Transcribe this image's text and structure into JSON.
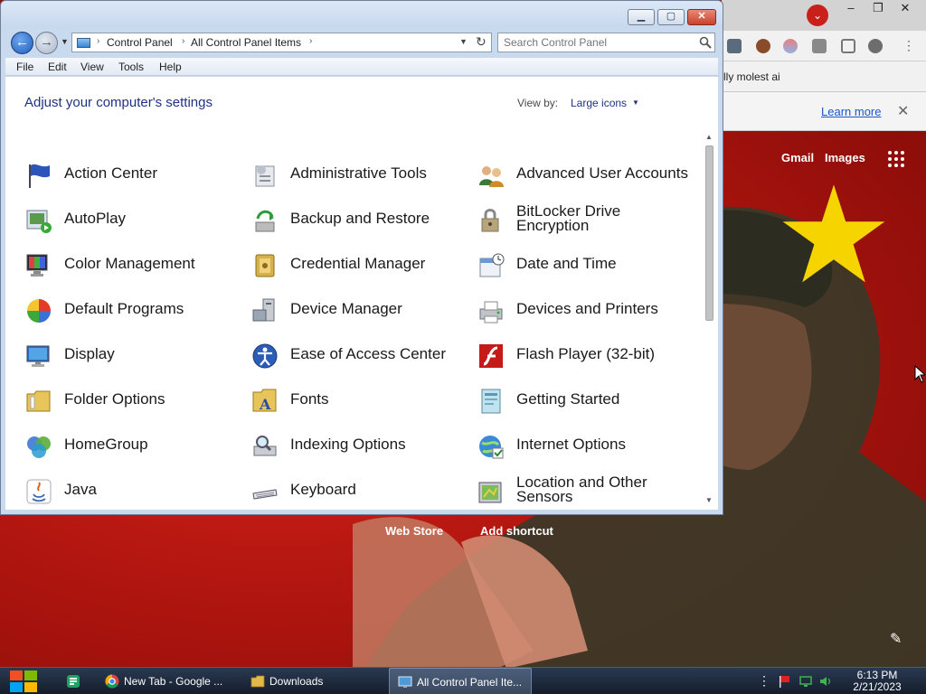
{
  "browser": {
    "bookmark_snippet": "lly molest ai",
    "learn_more": "Learn more",
    "gmail": "Gmail",
    "images": "Images",
    "web_store": "Web Store",
    "add_shortcut": "Add shortcut"
  },
  "window": {
    "breadcrumbs": [
      "Control Panel",
      "All Control Panel Items"
    ],
    "search_placeholder": "Search Control Panel",
    "menu": [
      "File",
      "Edit",
      "View",
      "Tools",
      "Help"
    ],
    "heading": "Adjust your computer's settings",
    "view_by_label": "View by:",
    "view_by_value": "Large icons"
  },
  "items": [
    {
      "label": "Action Center",
      "icon": "action-center-flag-icon"
    },
    {
      "label": "Administrative Tools",
      "icon": "admin-tools-icon"
    },
    {
      "label": "Advanced User Accounts",
      "icon": "user-accounts-icon"
    },
    {
      "label": "AutoPlay",
      "icon": "autoplay-icon"
    },
    {
      "label": "Backup and Restore",
      "icon": "backup-restore-icon"
    },
    {
      "label": "BitLocker Drive Encryption",
      "icon": "bitlocker-icon"
    },
    {
      "label": "Color Management",
      "icon": "color-management-icon"
    },
    {
      "label": "Credential Manager",
      "icon": "credential-manager-icon"
    },
    {
      "label": "Date and Time",
      "icon": "date-time-icon"
    },
    {
      "label": "Default Programs",
      "icon": "default-programs-icon"
    },
    {
      "label": "Device Manager",
      "icon": "device-manager-icon"
    },
    {
      "label": "Devices and Printers",
      "icon": "devices-printers-icon"
    },
    {
      "label": "Display",
      "icon": "display-icon"
    },
    {
      "label": "Ease of Access Center",
      "icon": "ease-of-access-icon"
    },
    {
      "label": "Flash Player (32-bit)",
      "icon": "flash-player-icon"
    },
    {
      "label": "Folder Options",
      "icon": "folder-options-icon"
    },
    {
      "label": "Fonts",
      "icon": "fonts-icon"
    },
    {
      "label": "Getting Started",
      "icon": "getting-started-icon"
    },
    {
      "label": "HomeGroup",
      "icon": "homegroup-icon"
    },
    {
      "label": "Indexing Options",
      "icon": "indexing-options-icon"
    },
    {
      "label": "Internet Options",
      "icon": "internet-options-icon"
    },
    {
      "label": "Java",
      "icon": "java-icon"
    },
    {
      "label": "Keyboard",
      "icon": "keyboard-icon"
    },
    {
      "label": "Location and Other Sensors",
      "icon": "location-sensors-icon"
    }
  ],
  "taskbar": {
    "apps": [
      {
        "label": "New Tab - Google ...",
        "icon": "chrome-icon",
        "active": false
      },
      {
        "label": "Downloads",
        "icon": "folder-icon",
        "active": false
      },
      {
        "label": "All Control Panel Ite...",
        "icon": "control-panel-icon",
        "active": true
      }
    ],
    "time": "6:13 PM",
    "date": "2/21/2023"
  },
  "colors": {
    "window_frame": "#c9d9ee",
    "heading_blue": "#1e3287",
    "link_blue": "#1a56c8",
    "poster_red": "#b0150f",
    "taskbar": "#1b2638"
  }
}
